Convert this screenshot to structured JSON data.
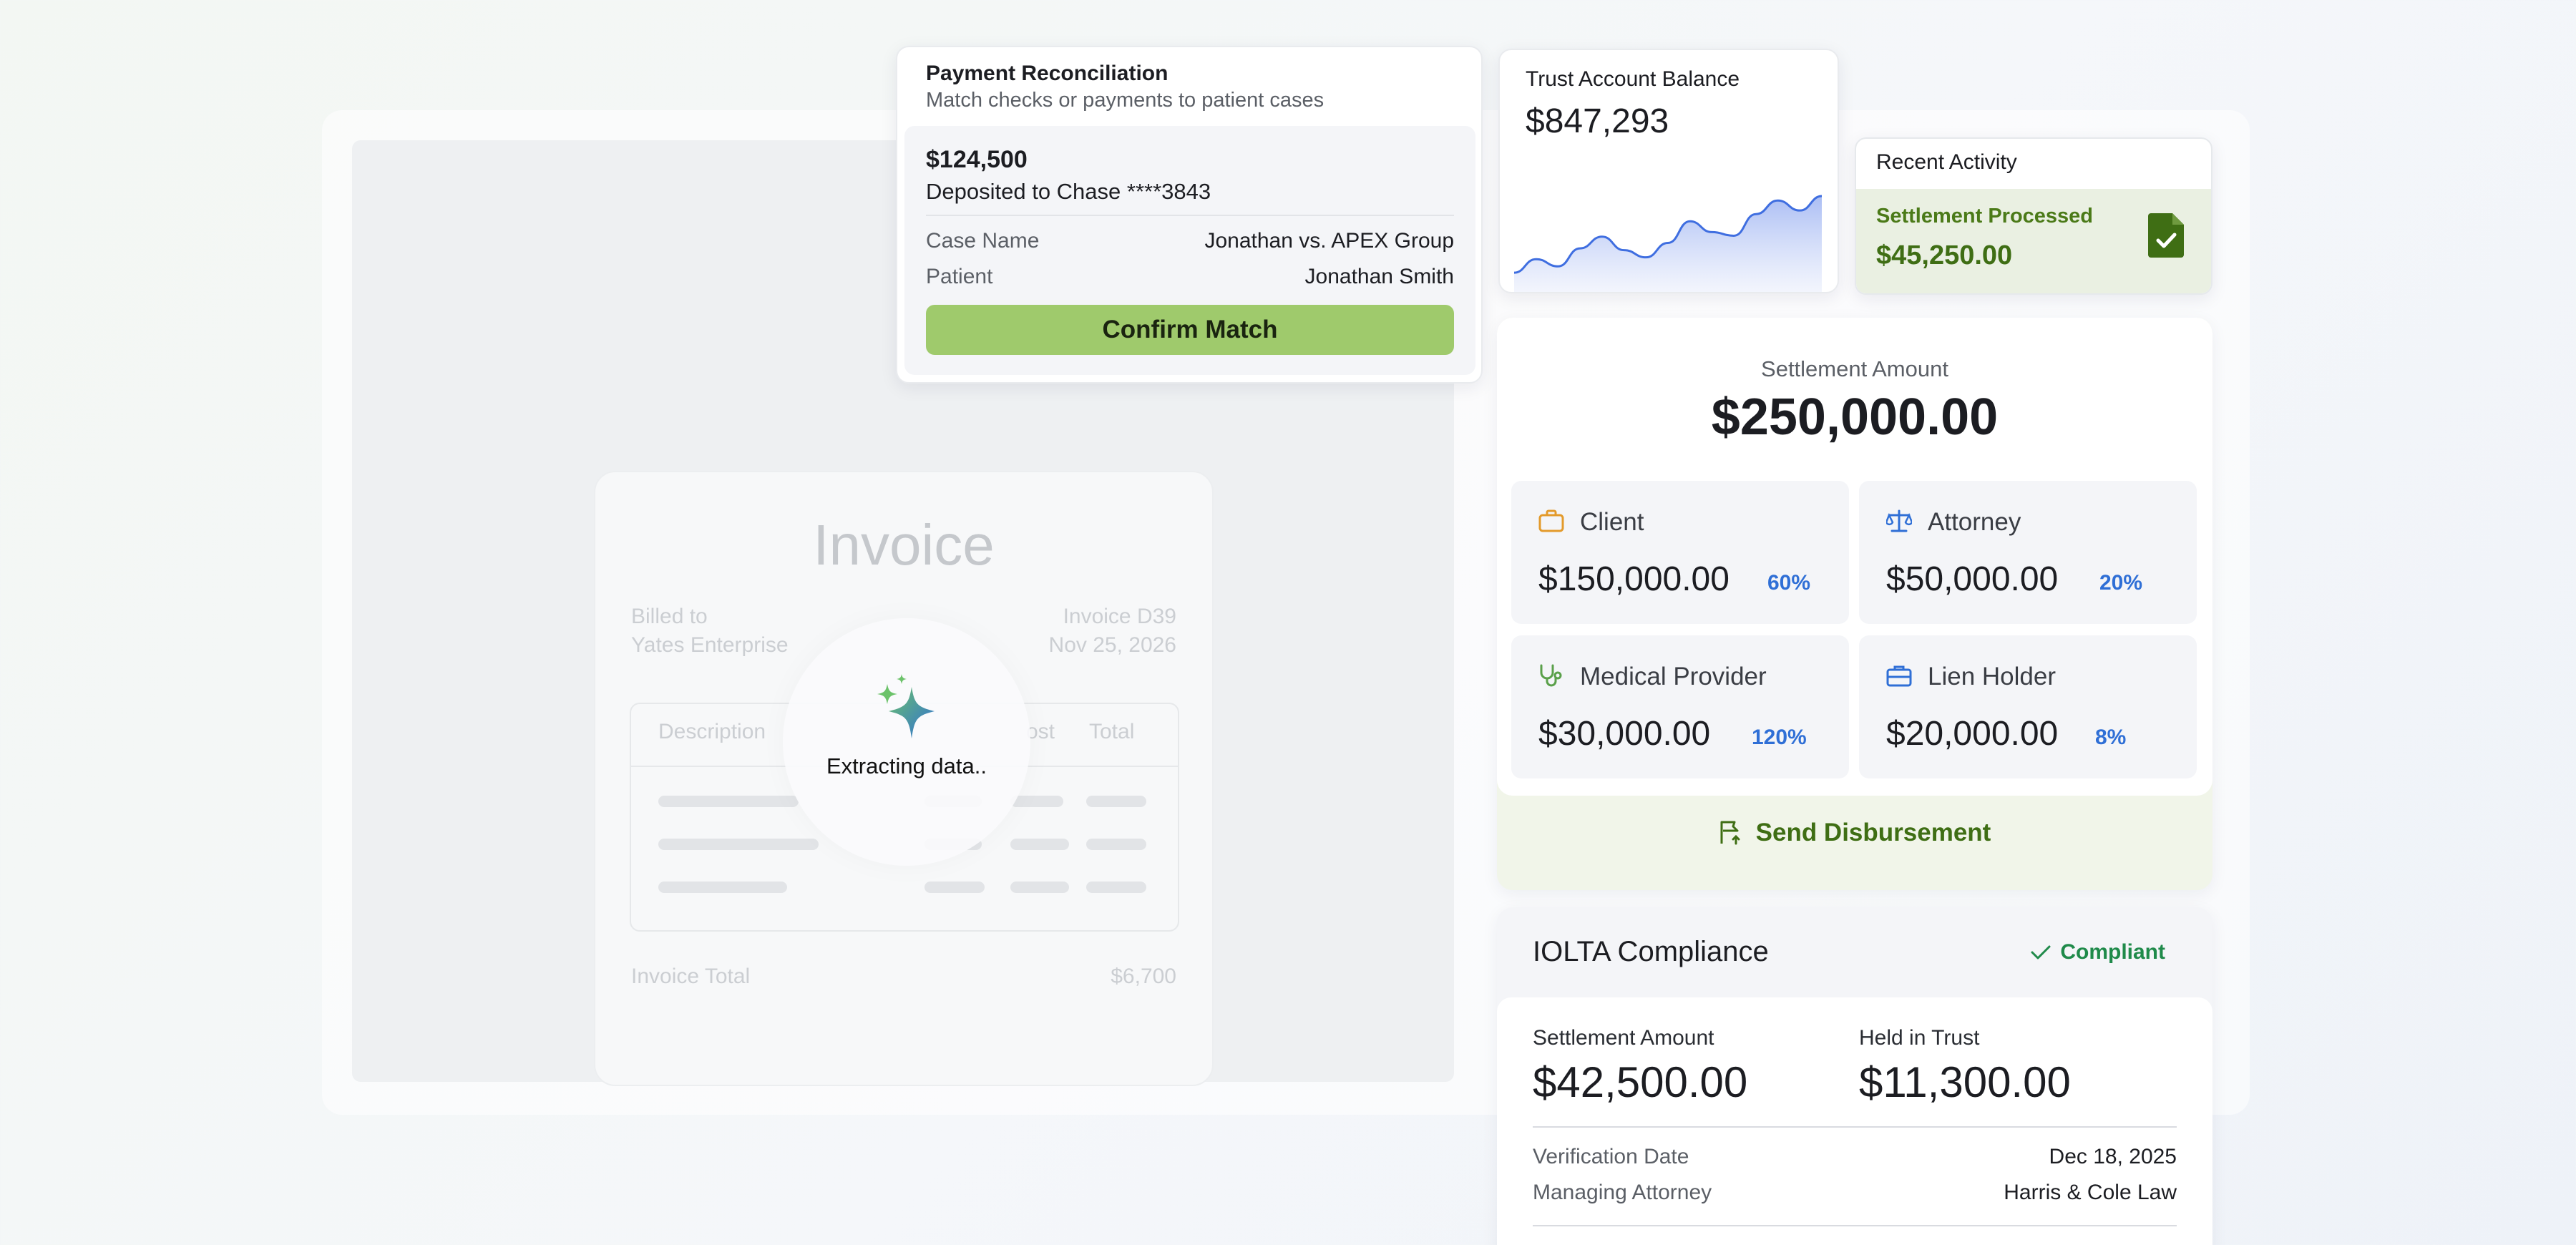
{
  "payment_reconciliation": {
    "title": "Payment Reconciliation",
    "subtitle": "Match checks or payments to patient cases",
    "amount": "$124,500",
    "deposited_to": "Deposited to Chase ****3843",
    "case_name_label": "Case Name",
    "case_name_value": "Jonathan vs. APEX Group",
    "patient_label": "Patient",
    "patient_value": "Jonathan Smith",
    "confirm_label": "Confirm Match"
  },
  "trust_account": {
    "title": "Trust Account Balance",
    "balance": "$847,293",
    "trend": [
      0.15,
      0.3,
      0.22,
      0.42,
      0.55,
      0.4,
      0.32,
      0.48,
      0.72,
      0.6,
      0.56,
      0.8,
      0.95,
      0.84,
      1.0
    ]
  },
  "recent_activity": {
    "title": "Recent Activity",
    "label": "Settlement Processed",
    "amount": "$45,250.00"
  },
  "invoice": {
    "title": "Invoice",
    "billed_to_label": "Billed to",
    "billed_to_value": "Yates Enterprise",
    "invoice_number": "Invoice D39",
    "invoice_date": "Nov 25, 2026",
    "columns": [
      "Description",
      "ost",
      "Total"
    ],
    "total_label": "Invoice Total",
    "total_value": "$6,700",
    "extracting_text": "Extracting data.."
  },
  "settlement": {
    "label": "Settlement Amount",
    "amount": "$250,000.00",
    "tiles": [
      {
        "name": "Client",
        "value": "$150,000.00",
        "pct": "60%"
      },
      {
        "name": "Attorney",
        "value": "$50,000.00",
        "pct": "20%"
      },
      {
        "name": "Medical Provider",
        "value": "$30,000.00",
        "pct": "120%"
      },
      {
        "name": "Lien Holder",
        "value": "$20,000.00",
        "pct": "8%"
      }
    ],
    "send_label": "Send Disbursement"
  },
  "iolta": {
    "title": "IOLTA Compliance",
    "status": "Compliant",
    "settlement_label": "Settlement Amount",
    "settlement_value": "$42,500.00",
    "held_label": "Held in Trust",
    "held_value": "$11,300.00",
    "verification_label": "Verification Date",
    "verification_value": "Dec 18, 2025",
    "attorney_label": "Managing Attorney",
    "attorney_value": "Harris & Cole Law"
  },
  "colors": {
    "accent_green": "#9fca6c",
    "dark_green": "#3f6e14",
    "blue": "#2f6fd6",
    "compliant": "#1f8a4a"
  }
}
